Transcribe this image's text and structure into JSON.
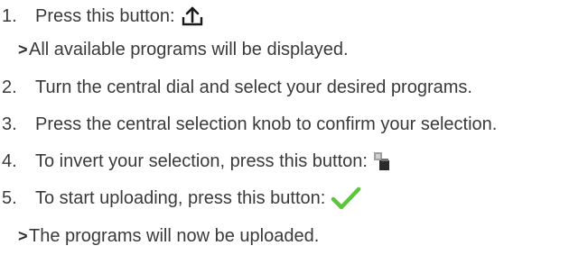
{
  "instructions": {
    "step1": {
      "number": "1.",
      "text": "Press this button:",
      "icon": "upload-icon"
    },
    "result1": {
      "marker": ">",
      "text": "All available programs will be displayed."
    },
    "step2": {
      "number": "2.",
      "text": "Turn the central dial and select your desired programs."
    },
    "step3": {
      "number": "3.",
      "text": "Press the central selection knob to confirm your selection."
    },
    "step4": {
      "number": "4.",
      "text": "To invert your selection, press this button:",
      "icon": "invert-selection-icon"
    },
    "step5": {
      "number": "5.",
      "text": "To start uploading, press this button:",
      "icon": "checkmark-icon"
    },
    "result2": {
      "marker": ">",
      "text": "The programs will now be uploaded."
    }
  },
  "colors": {
    "text": "#3a3a3a",
    "checkmark": "#5cc63a",
    "invert_icon_light": "#a0a0a0",
    "invert_icon_dark": "#2a2a2a"
  }
}
